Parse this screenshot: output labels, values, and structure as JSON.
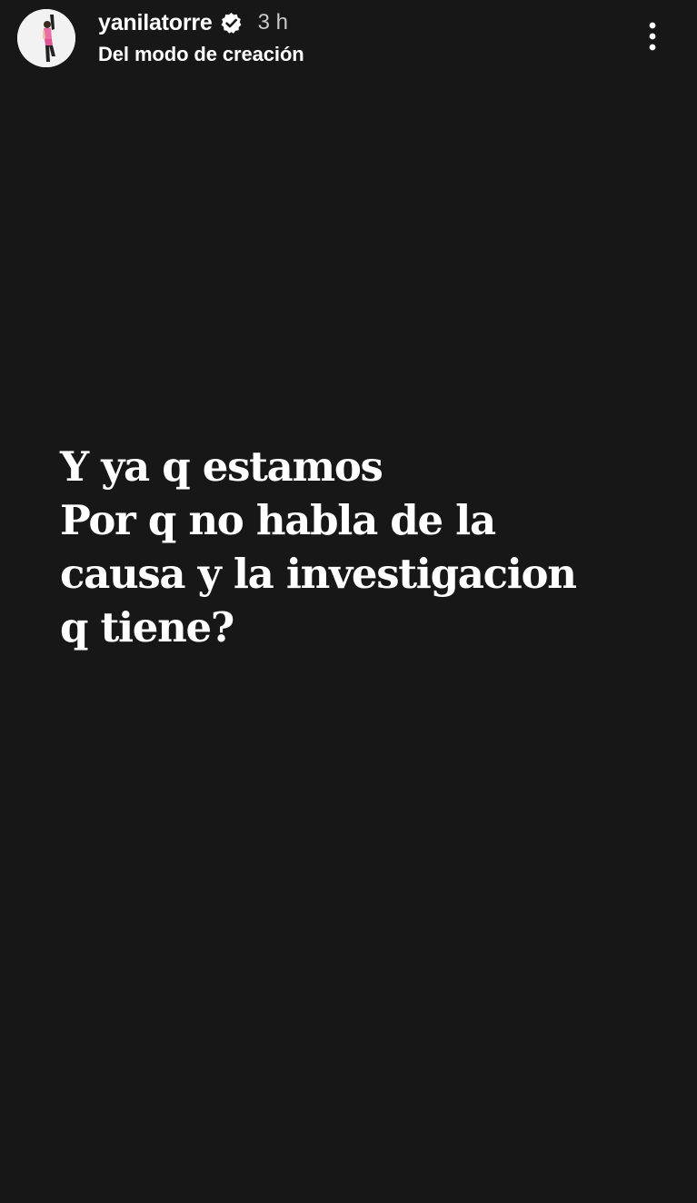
{
  "header": {
    "username": "yanilatorre",
    "time": "3 h",
    "subtitle": "Del modo de creación",
    "avatar_icon": "profile-photo",
    "verified_icon": "verified-badge-icon",
    "more_icon": "more-vertical-icon"
  },
  "story": {
    "background_color": "#171717",
    "text_color": "#ffffff",
    "lines": [
      "Y ya q estamos",
      "Por q no habla de la",
      "causa y la investigacion",
      "q tiene?"
    ]
  }
}
